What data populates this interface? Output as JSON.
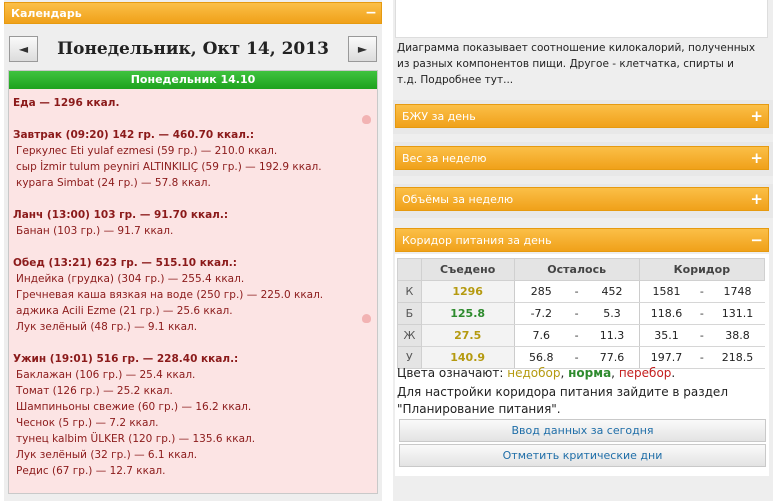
{
  "calendar": {
    "title": "Календарь",
    "collapse_icon": "minus-icon",
    "prev_label": "◄",
    "next_label": "►",
    "date_title": "Понедельник, Окт 14, 2013",
    "day_header": "Понедельник 14.10",
    "total": "Еда — 1296 ккал.",
    "meals": [
      {
        "title": "Завтрак (09:20) 142 гр. — 460.70 ккал.:",
        "items": [
          "Геркулес Eti yulaf ezmesi (59 гр.) — 210.0 ккал.",
          "сыр İzmir tulum peyniri ALTINKILIÇ (59 гр.) — 192.9 ккал.",
          "курага Simbat (24 гр.) — 57.8 ккал."
        ]
      },
      {
        "title": "Ланч (13:00) 103 гр. — 91.70 ккал.:",
        "items": [
          "Банан (103 гр.) — 91.7 ккал."
        ]
      },
      {
        "title": "Обед (13:21) 623 гр. — 515.10 ккал.:",
        "items": [
          "Индейка (грудка) (304 гр.) — 255.4 ккал.",
          "Гречневая каша вязкая на воде (250 гр.) — 225.0 ккал.",
          "аджика Acili Ezme (21 гр.) — 25.6 ккал.",
          "Лук зелёный (48 гр.) — 9.1 ккал."
        ]
      },
      {
        "title": "Ужин (19:01) 516 гр. — 228.40 ккал.:",
        "items": [
          "Баклажан (106 гр.) — 25.4 ккал.",
          "Томат (126 гр.) — 25.2 ккал.",
          "Шампиньоны свежие (60 гр.) — 16.2 ккал.",
          "Чеснок (5 гр.) — 7.2 ккал.",
          "тунец kalbim ÜLKER (120 гр.) — 135.6 ккал.",
          "Лук зелёный (32 гр.) — 6.1 ккал.",
          "Редис (67 гр.) — 12.7 ккал."
        ]
      }
    ]
  },
  "right": {
    "diagram_text": "Диаграмма показывает соотношение килокалорий, полученных из разных компонентов пищи. Другое - клетчатка, спирты и т.д. Подробнее тут...",
    "widgets": [
      "БЖУ за день",
      "Вес за неделю",
      "Объёмы за неделю"
    ],
    "corridor_title": "Коридор питания за день",
    "table": {
      "headers": [
        "Съедено",
        "Осталось",
        "Коридор"
      ],
      "rows": [
        {
          "label": "К",
          "eaten": "1296",
          "rem_min": "285",
          "rem_max": "452",
          "cor_min": "1581",
          "cor_max": "1748",
          "status": "amber"
        },
        {
          "label": "Б",
          "eaten": "125.8",
          "rem_min": "-7.2",
          "rem_max": "5.3",
          "cor_min": "118.6",
          "cor_max": "131.1",
          "status": "green"
        },
        {
          "label": "Ж",
          "eaten": "27.5",
          "rem_min": "7.6",
          "rem_max": "11.3",
          "cor_min": "35.1",
          "cor_max": "38.8",
          "status": "amber"
        },
        {
          "label": "У",
          "eaten": "140.9",
          "rem_min": "56.8",
          "rem_max": "77.6",
          "cor_min": "197.7",
          "cor_max": "218.5",
          "status": "amber"
        }
      ],
      "separator": "-"
    },
    "legend_prefix": "Цвета означают:",
    "legend_under": "недобор",
    "legend_norm": "норма",
    "legend_over": "перебор",
    "setup_note": "Для настройки коридора питания зайдите в раздел \"Планирование питания\".",
    "btn_enter": "Ввод данных за сегодня",
    "btn_critical": "Отметить критические дни"
  },
  "colors": {
    "accent_orange": "#f0a11a",
    "day_green": "#1ea21e",
    "under": "#b59a10",
    "norm": "#2e8b2e",
    "over": "#c41e1e"
  }
}
